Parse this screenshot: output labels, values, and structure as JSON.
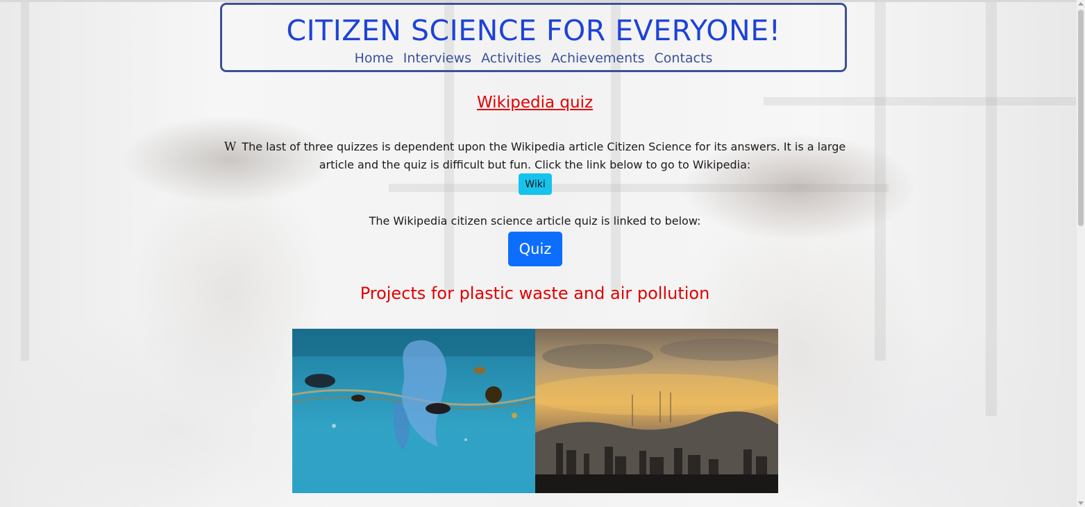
{
  "header": {
    "title": "CITIZEN SCIENCE FOR EVERYONE!",
    "nav": [
      {
        "label": "Home"
      },
      {
        "label": "Interviews"
      },
      {
        "label": "Activities"
      },
      {
        "label": "Achievements"
      },
      {
        "label": "Contacts"
      }
    ]
  },
  "main": {
    "heading": "Wikipedia quiz",
    "wiki_glyph": "W",
    "intro_text": "The last of three quizzes is dependent upon the Wikipedia article Citizen Science for its answers. It is a large article and the quiz is difficult but fun. Click the link below to go to Wikipedia:",
    "wiki_button": "Wiki",
    "quiz_intro": "The Wikipedia citizen science article quiz is linked to below:",
    "quiz_button": "Quiz",
    "projects_heading": "Projects for plastic waste and air pollution"
  },
  "images": [
    {
      "name": "plastic-waste-ocean-image",
      "depicts": "plastic bag floating underwater"
    },
    {
      "name": "air-pollution-city-image",
      "depicts": "hazy sunset skyline over city"
    }
  ],
  "colors": {
    "title": "#1d43d6",
    "nav": "#3a509a",
    "header_border": "#3a509a",
    "heading_red": "#e10000",
    "wiki_button": "#16c3ec",
    "quiz_button": "#0d6efd"
  }
}
